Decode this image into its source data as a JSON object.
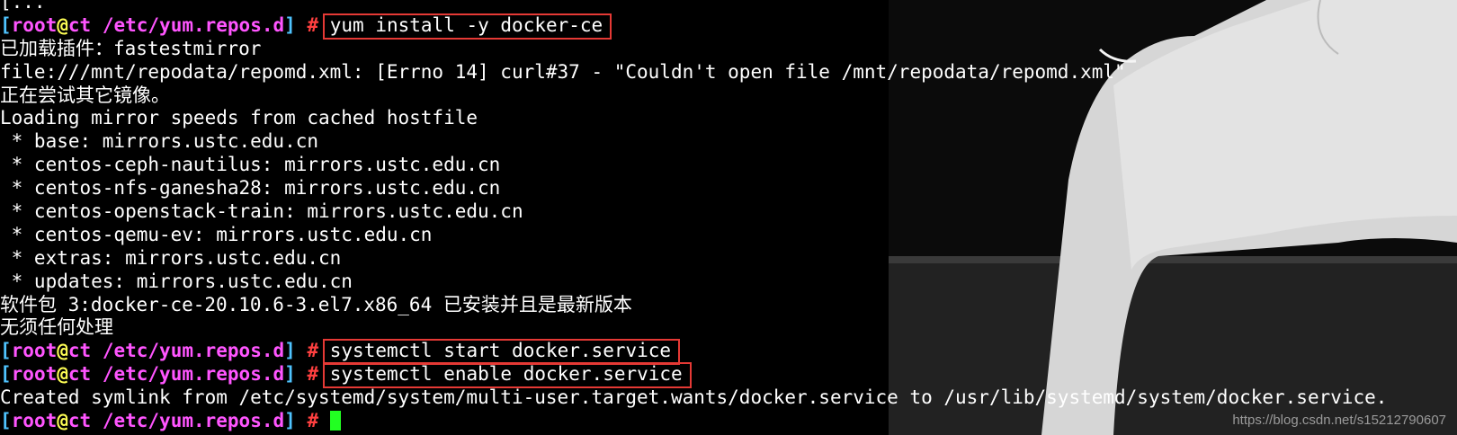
{
  "prompt": {
    "open": "[",
    "user": "root",
    "at": "@",
    "host": "ct",
    "path": "/etc/yum.repos.d",
    "close": "]",
    "symbol": "#"
  },
  "lines": [
    {
      "type": "text",
      "text": "[..."
    },
    {
      "type": "prompt",
      "command": "yum install -y docker-ce"
    },
    {
      "type": "text",
      "text": "已加载插件：fastestmirror"
    },
    {
      "type": "text",
      "text": "file:///mnt/repodata/repomd.xml: [Errno 14] curl#37 - \"Couldn't open file /mnt/repodata/repomd.xml\""
    },
    {
      "type": "text",
      "text": "正在尝试其它镜像。"
    },
    {
      "type": "text",
      "text": "Loading mirror speeds from cached hostfile"
    },
    {
      "type": "text",
      "text": " * base: mirrors.ustc.edu.cn"
    },
    {
      "type": "text",
      "text": " * centos-ceph-nautilus: mirrors.ustc.edu.cn"
    },
    {
      "type": "text",
      "text": " * centos-nfs-ganesha28: mirrors.ustc.edu.cn"
    },
    {
      "type": "text",
      "text": " * centos-openstack-train: mirrors.ustc.edu.cn"
    },
    {
      "type": "text",
      "text": " * centos-qemu-ev: mirrors.ustc.edu.cn"
    },
    {
      "type": "text",
      "text": " * extras: mirrors.ustc.edu.cn"
    },
    {
      "type": "text",
      "text": " * updates: mirrors.ustc.edu.cn"
    },
    {
      "type": "text",
      "text": "软件包 3:docker-ce-20.10.6-3.el7.x86_64 已安装并且是最新版本"
    },
    {
      "type": "text",
      "text": "无须任何处理"
    },
    {
      "type": "prompt",
      "command": "systemctl start docker.service"
    },
    {
      "type": "prompt",
      "command": "systemctl enable docker.service"
    },
    {
      "type": "text",
      "text": "Created symlink from /etc/systemd/system/multi-user.target.wants/docker.service to /usr/lib/systemd/system/docker.service."
    },
    {
      "type": "prompt",
      "command": "",
      "cursor": true
    }
  ],
  "watermark": "https://blog.csdn.net/s15212790607",
  "colors": {
    "background": "#000000",
    "text": "#ffffff",
    "highlight_box": "#e53935",
    "cursor": "#22ff22"
  }
}
